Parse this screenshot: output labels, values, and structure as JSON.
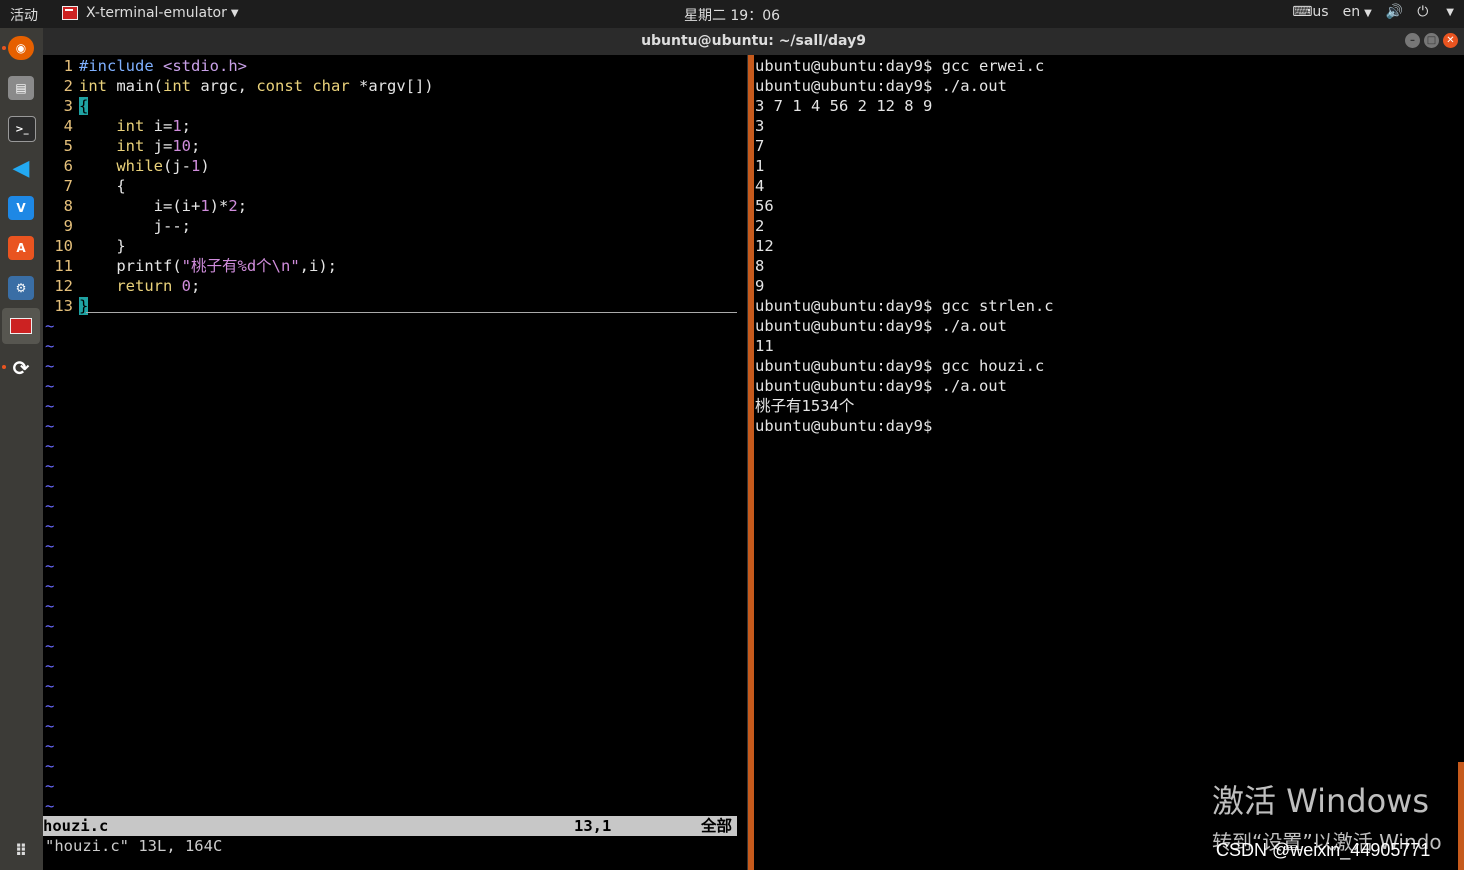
{
  "topbar": {
    "activities": "活动",
    "app_name": "X-terminal-emulator",
    "clock": "星期二 19：06",
    "keyboard": "us",
    "lang": "en"
  },
  "window": {
    "title": "ubuntu@ubuntu: ~/sall/day9"
  },
  "vim": {
    "lines": [
      {
        "n": "1"
      },
      {
        "n": "2"
      },
      {
        "n": "3"
      },
      {
        "n": "4"
      },
      {
        "n": "5"
      },
      {
        "n": "6"
      },
      {
        "n": "7"
      },
      {
        "n": "8"
      },
      {
        "n": "9"
      },
      {
        "n": "10"
      },
      {
        "n": "11"
      },
      {
        "n": "12"
      },
      {
        "n": "13"
      }
    ],
    "tilde": "~",
    "status_file": "houzi.c",
    "status_pos": "13,1",
    "status_all": "全部",
    "message": "\"houzi.c\" 13L, 164C"
  },
  "shell": {
    "lines": [
      "ubuntu@ubuntu:day9$ gcc erwei.c",
      "ubuntu@ubuntu:day9$ ./a.out",
      "3 7 1 4 56 2 12 8 9",
      "3",
      "7",
      "1",
      "4",
      "56",
      "2",
      "12",
      "8",
      "9",
      "ubuntu@ubuntu:day9$ gcc strlen.c",
      "ubuntu@ubuntu:day9$ ./a.out",
      "11",
      "ubuntu@ubuntu:day9$ gcc houzi.c",
      "ubuntu@ubuntu:day9$ ./a.out",
      "桃子有1534个",
      "ubuntu@ubuntu:day9$"
    ]
  },
  "watermark": {
    "title": "激活 Windows",
    "subtitle": "转到“设置”以激活 Windo",
    "csdn": "CSDN @weixin_44905771"
  },
  "colors": {
    "accent": "#e95420",
    "divider": "#c65a1c"
  }
}
